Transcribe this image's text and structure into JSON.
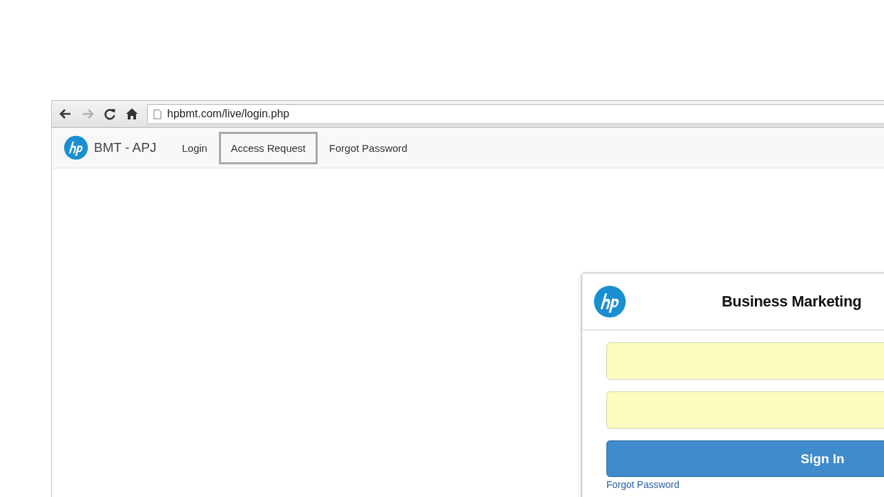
{
  "toolbar": {
    "buttons": [
      {
        "kind": "back",
        "disabled": false
      },
      {
        "kind": "forward",
        "disabled": true
      },
      {
        "kind": "reload",
        "disabled": false
      },
      {
        "kind": "home",
        "disabled": false
      }
    ],
    "url": "hpbmt.com/live/login.php"
  },
  "navbar": {
    "brand": "BMT - APJ",
    "links": [
      {
        "label": "Login",
        "selected": false
      },
      {
        "label": "Access Request",
        "selected": true
      },
      {
        "label": "Forgot Password",
        "selected": false
      }
    ]
  },
  "login_card": {
    "title": "Business Marketing",
    "button": "Sign In",
    "link": "Forgot Password"
  }
}
